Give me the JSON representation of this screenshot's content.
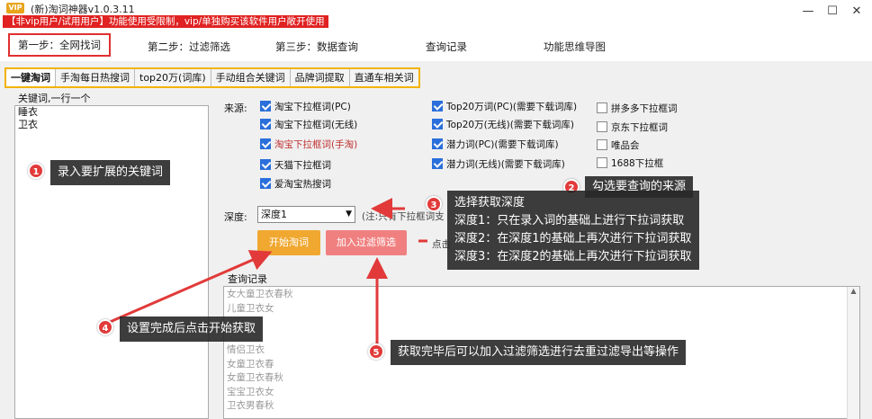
{
  "window": {
    "vip_badge": "VIP",
    "title": "(新)淘词神器v1.0.3.11",
    "warning": "【非vip用户/试用用户】功能使用受限制，vip/单独购买该软件用户敞开使用",
    "minimize": "—",
    "maximize": "☐",
    "close": "✕"
  },
  "steps": [
    "第一步：全网找词",
    "第二步：过滤筛选",
    "第三步：数据查询",
    "查询记录",
    "功能思维导图"
  ],
  "tabs": [
    "一键淘词",
    "手淘每日热搜词",
    "top20万(词库)",
    "手动组合关键词",
    "品牌词提取",
    "直通车相关词"
  ],
  "keywords": {
    "label": "关键词,一行一个",
    "items": [
      "睡衣",
      "卫衣"
    ]
  },
  "sources": {
    "label": "来源:",
    "col1": [
      {
        "label": "淘宝下拉框词(PC)",
        "checked": true,
        "red": false
      },
      {
        "label": "淘宝下拉框词(无线)",
        "checked": true,
        "red": false
      },
      {
        "label": "淘宝下拉框词(手淘)",
        "checked": true,
        "red": true
      },
      {
        "label": "天猫下拉框词",
        "checked": true,
        "red": false
      },
      {
        "label": "爱淘宝热搜词",
        "checked": true,
        "red": false
      }
    ],
    "col2": [
      {
        "label": "Top20万词(PC)(需要下载词库)",
        "checked": true
      },
      {
        "label": "Top20万(无线)(需要下载词库)",
        "checked": true
      },
      {
        "label": "潜力词(PC)(需要下载词库)",
        "checked": true
      },
      {
        "label": "潜力词(无线)(需要下载词库)",
        "checked": true
      }
    ],
    "col3": [
      {
        "label": "拼多多下拉框词",
        "checked": false
      },
      {
        "label": "京东下拉框词",
        "checked": false
      },
      {
        "label": "唯品会",
        "checked": false
      },
      {
        "label": "1688下拉框",
        "checked": false
      }
    ]
  },
  "depth": {
    "label": "深度:",
    "value": "深度1",
    "note": "(注:只有下拉框词支",
    "arrow": "▼"
  },
  "buttons": {
    "start": "开始淘词",
    "filter": "加入过滤筛选",
    "tip": "点击"
  },
  "history": {
    "label": "查询记录",
    "items": [
      "女大童卫衣春秋",
      "儿童卫衣女",
      "",
      "",
      "情侣卫衣",
      "女童卫衣春",
      "女童卫衣春秋",
      "宝宝卫衣女",
      "卫衣男春秋"
    ],
    "scroll_up": "▲"
  },
  "callouts": {
    "c1": {
      "num": "1",
      "text": "录入要扩展的关键词"
    },
    "c2": {
      "num": "2",
      "text": "勾选要查询的来源"
    },
    "c3": {
      "num": "3",
      "lines": [
        "选择获取深度",
        "深度1：只在录入词的基础上进行下拉词获取",
        "深度2：在深度1的基础上再次进行下拉词获取",
        "深度3：在深度2的基础上再次进行下拉词获取"
      ]
    },
    "c4": {
      "num": "4",
      "text": "设置完成后点击开始获取"
    },
    "c5": {
      "num": "5",
      "text": "获取完毕后可以加入过滤筛选进行去重过滤导出等操作"
    }
  },
  "colors": {
    "accent": "#e03030",
    "tab_border": "#f2b300",
    "start_btn": "#f0a830",
    "filter_btn": "#f08080"
  }
}
